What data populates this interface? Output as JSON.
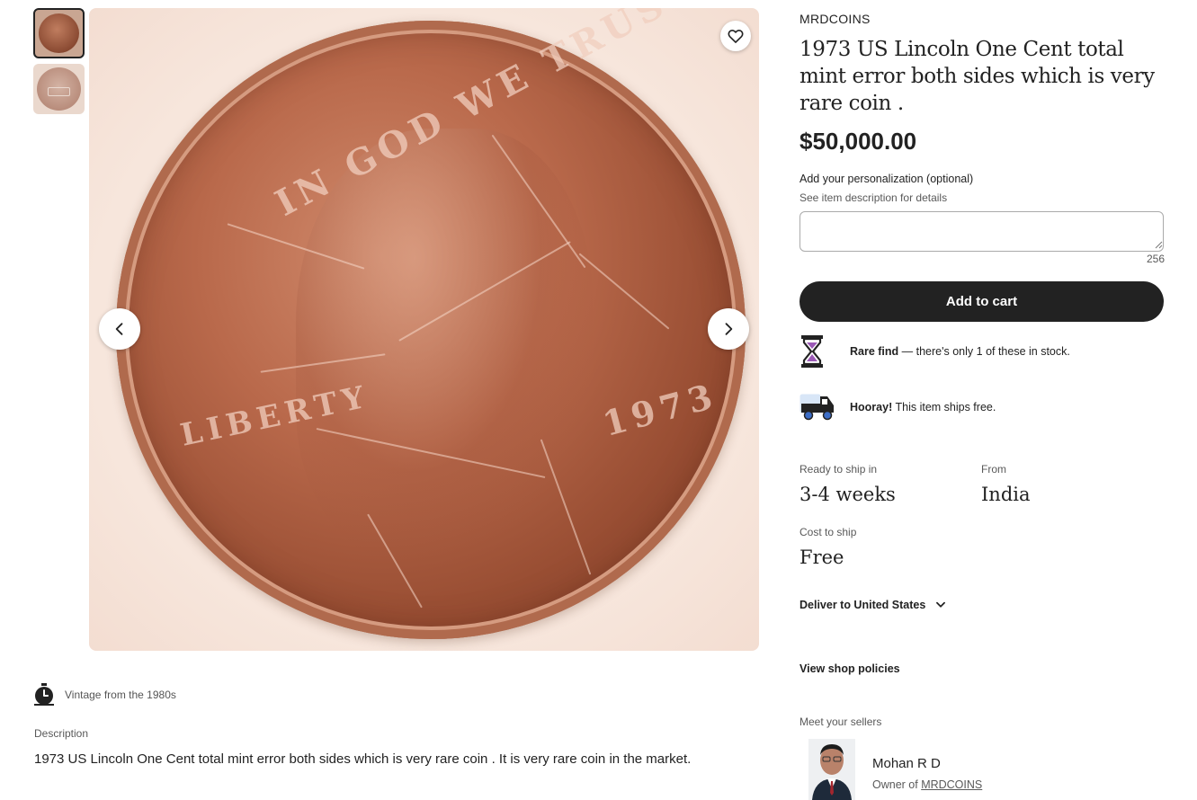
{
  "gallery": {
    "thumbnails": [
      {
        "name": "coin obverse thumbnail",
        "active": true
      },
      {
        "name": "coin reverse thumbnail",
        "active": false
      }
    ],
    "coin_legend_top": "IN GOD WE TRUST",
    "coin_legend_left": "LIBERTY",
    "coin_date": "1973",
    "favorite_icon": "heart-icon",
    "prev_icon": "chevron-left-icon",
    "next_icon": "chevron-right-icon"
  },
  "details": {
    "vintage_icon": "stopwatch-icon",
    "vintage_text": "Vintage from the 1980s",
    "description_label": "Description",
    "description_text": "1973 US Lincoln One Cent total mint error both sides which is very rare coin . It is very rare coin in the market."
  },
  "listing": {
    "shop_name": "MRDCOINS",
    "title": "1973 US Lincoln One Cent total mint error both sides which is very rare coin .",
    "price": "$50,000.00",
    "personalization_label": "Add your personalization (optional)",
    "personalization_help": "See item description for details",
    "personalization_value": "",
    "char_remaining": "256",
    "add_to_cart": "Add to cart",
    "rare_bold": "Rare find",
    "rare_text": " — there's only 1 of these in stock.",
    "ship_bold": "Hooray!",
    "ship_text": " This item ships free.",
    "ready_label": "Ready to ship in",
    "ready_value": "3-4 weeks",
    "from_label": "From",
    "from_value": "India",
    "cost_label": "Cost to ship",
    "cost_value": "Free",
    "deliver_text": "Deliver to United States",
    "policies": "View shop policies",
    "meet_sellers": "Meet your sellers",
    "seller_name": "Mohan R D",
    "owner_prefix": "Owner of ",
    "owner_shop": "MRDCOINS"
  },
  "colors": {
    "button_dark": "#222222",
    "hourglass_sand": "#9b59b6",
    "truck_blue": "#3c6dc6"
  }
}
